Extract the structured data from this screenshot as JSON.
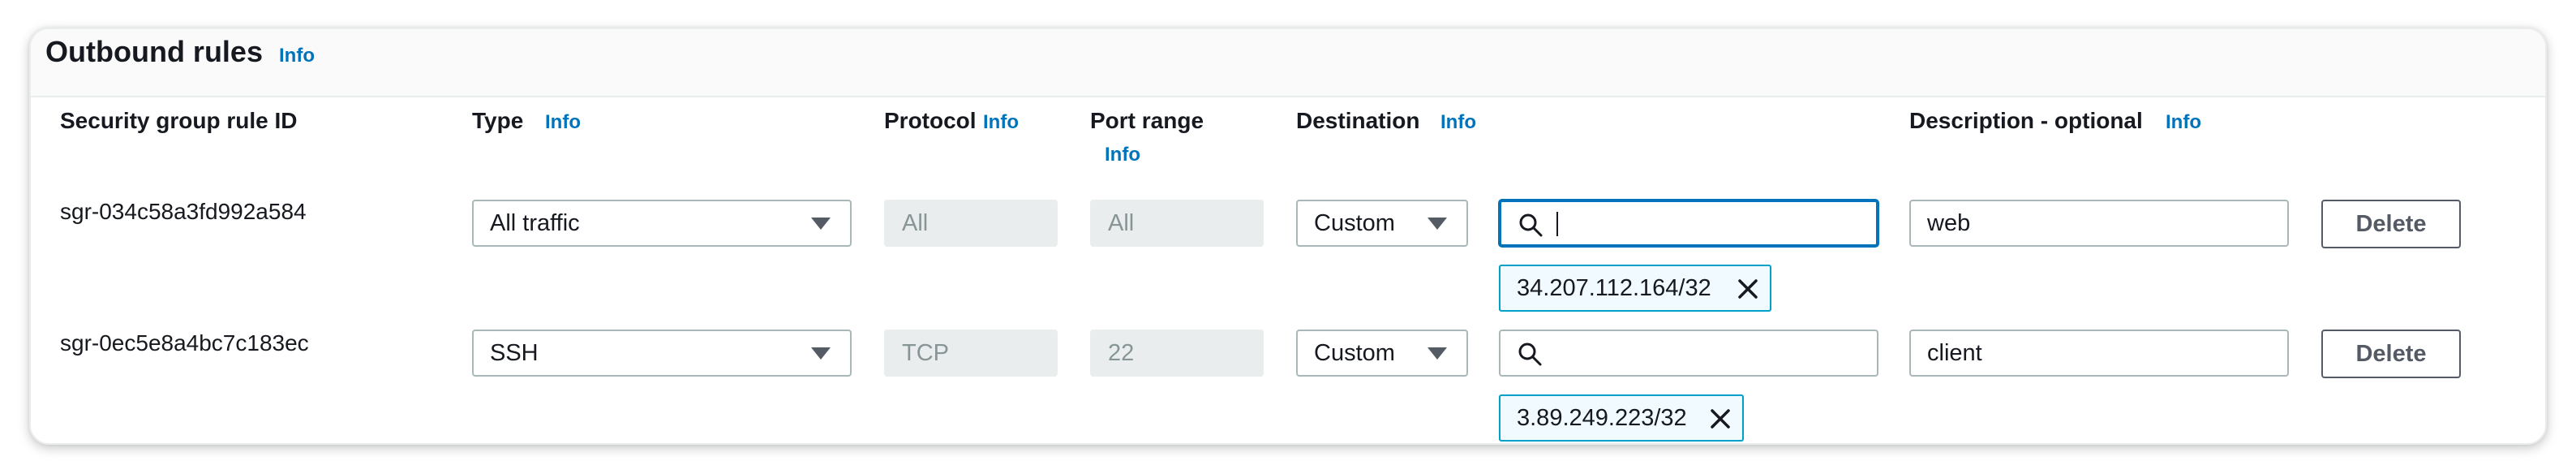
{
  "section": {
    "title": "Outbound rules",
    "info": "Info"
  },
  "columns": {
    "rule_id": "Security group rule ID",
    "type": "Type",
    "protocol": "Protocol",
    "port_range": "Port range",
    "destination": "Destination",
    "description": "Description - optional",
    "info": "Info"
  },
  "rows": [
    {
      "rule_id": "sgr-034c58a3fd992a584",
      "type": "All traffic",
      "protocol": "All",
      "port_range": "All",
      "destination_type": "Custom",
      "destination_search": "",
      "destination_token": "34.207.112.164/32",
      "description": "web",
      "delete_label": "Delete"
    },
    {
      "rule_id": "sgr-0ec5e8a4bc7c183ec",
      "type": "SSH",
      "protocol": "TCP",
      "port_range": "22",
      "destination_type": "Custom",
      "destination_search": "",
      "destination_token": "3.89.249.223/32",
      "description": "client",
      "delete_label": "Delete"
    }
  ],
  "icons": {
    "search": "search-icon",
    "token_close": "close-icon",
    "select_caret": "caret-down-icon"
  },
  "colors": {
    "link": "#0073bb",
    "focus": "#0073bb",
    "token_border": "#00a1c9",
    "token_bg": "#f1faff",
    "disabled_bg": "#eaeded"
  }
}
